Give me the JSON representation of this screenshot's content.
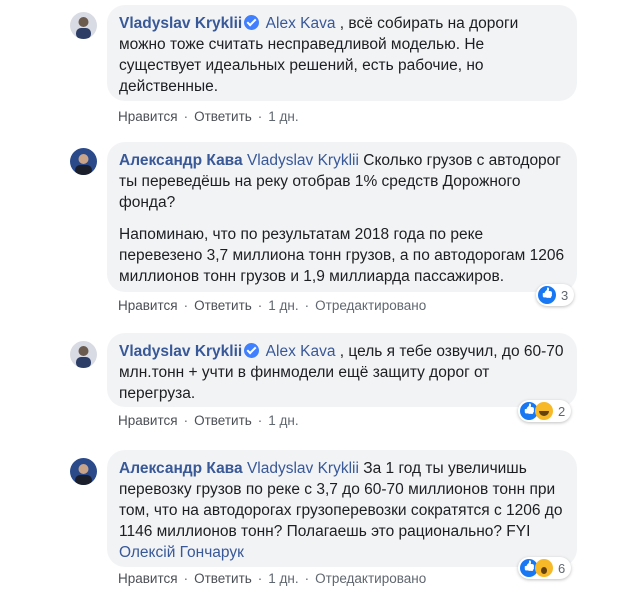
{
  "comments": [
    {
      "author": "Vladyslav Kryklii",
      "verified": true,
      "mention": "Alex Kava",
      "text": " , всё собирать на дороги можно тоже считать несправедливой моделью. Не существует идеальных решений, есть рабочие, но действенные.",
      "actions": {
        "like": "Нравится",
        "reply": "Ответить",
        "time": "1 дн."
      }
    },
    {
      "author": "Александр Кава",
      "verified": false,
      "mention": "Vladyslav Kryklii",
      "text": " Сколько грузов с автодорог ты переведёшь на реку отобрав 1% средств Дорожного фонда?",
      "text2": "Напоминаю, что по результатам 2018 года по реке перевезено 3,7 миллиона тонн грузов, а по автодорогам 1206 миллионов тонн грузов и 1,9 миллиарда пассажиров.",
      "actions": {
        "like": "Нравится",
        "reply": "Ответить",
        "time": "1 дн.",
        "edited": "Отредактировано"
      },
      "reactions": {
        "types": [
          "like"
        ],
        "count": "3"
      }
    },
    {
      "author": "Vladyslav Kryklii",
      "verified": true,
      "mention": "Alex Kava",
      "text": " , цель я тебе озвучил, до 60-70 млн.тонн + учти в финмодели ещё защиту дорог от перегруза.",
      "actions": {
        "like": "Нравится",
        "reply": "Ответить",
        "time": "1 дн."
      },
      "reactions": {
        "types": [
          "like",
          "laugh"
        ],
        "count": "2"
      }
    },
    {
      "author": "Александр Кава",
      "verified": false,
      "mention": "Vladyslav Kryklii",
      "text": " За 1 год ты увеличишь перевозку грузов по реке с 3,7 до 60-70 миллионов тонн при том, что на автодорогах грузоперевозки сократятся с 1206 до 1146 миллионов тонн? Полагаешь это рационально? FYI ",
      "mention2": "Олексій Гончарук",
      "actions": {
        "like": "Нравится",
        "reply": "Ответить",
        "time": "1 дн.",
        "edited": "Отредактировано"
      },
      "reactions": {
        "types": [
          "like",
          "wow"
        ],
        "count": "6"
      }
    }
  ],
  "separator": "·"
}
